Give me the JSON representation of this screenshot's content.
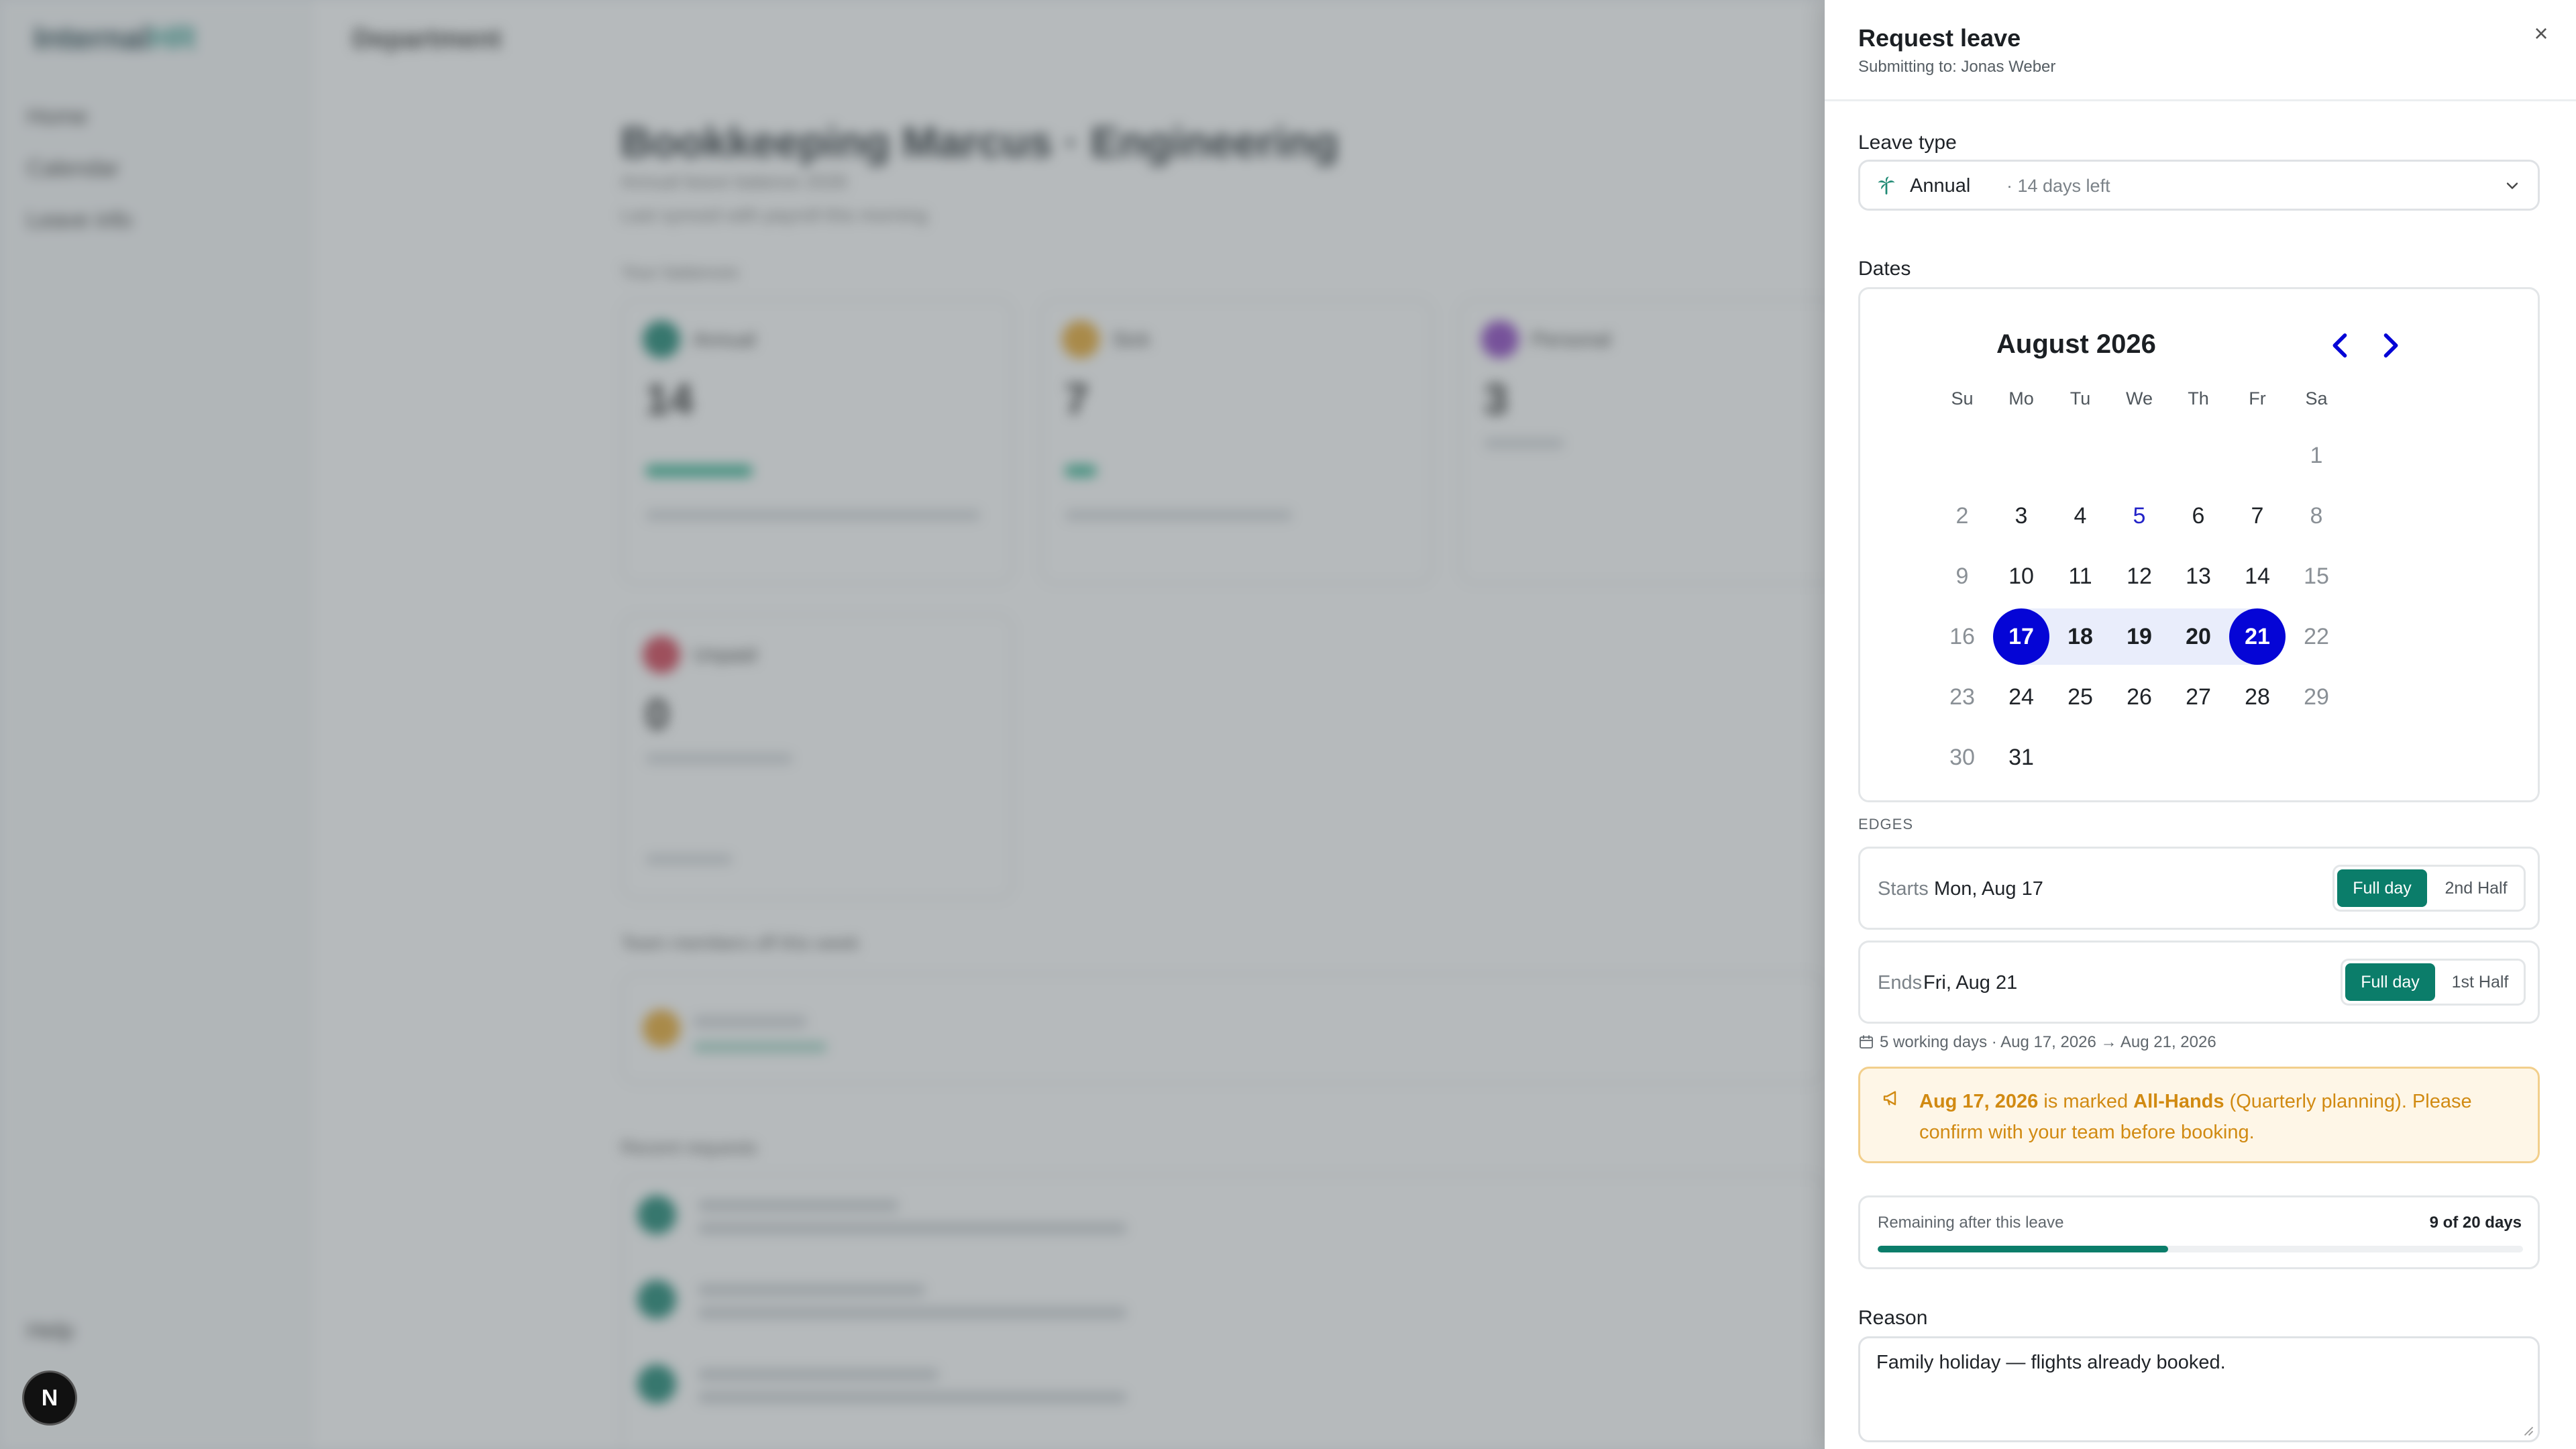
{
  "background": {
    "logo": {
      "part1": "Internal",
      "part2": "HR"
    },
    "topbar_title": "Department",
    "nav": [
      "Home",
      "Calendar",
      "Leave info"
    ],
    "bottom_nav": [
      "Help"
    ],
    "heading": "Bookkeeping Marcus · Engineering",
    "sub1": "Annual leave balance 2026",
    "sub2": "Last synced with payroll this morning",
    "section_balances": "Your balances",
    "cards": [
      {
        "label": "Annual",
        "value": "14",
        "color": "#15836f"
      },
      {
        "label": "Sick",
        "value": "7",
        "color": "#e8a72c"
      },
      {
        "label": "Personal",
        "value": "3",
        "color": "#8a3fc1"
      },
      {
        "label": "Unpaid",
        "value": "0",
        "color": "#d23b4f"
      }
    ],
    "section_team": "Team members off this week",
    "section_recent": "Recent requests",
    "badge_letter": "N"
  },
  "drawer": {
    "title": "Request leave",
    "subtitle": "Submitting to: Jonas Weber",
    "close_glyph": "×",
    "leave_type_label": "Leave type",
    "leave_type": {
      "selected": "Annual",
      "days_left": "· 14 days left",
      "icon": "palm-tree-icon"
    },
    "dates_label": "Dates",
    "calendar": {
      "month": "August 2026",
      "weekdays": [
        "Su",
        "Mo",
        "Tu",
        "We",
        "Th",
        "Fr",
        "Sa"
      ],
      "first_weekday_index": 6,
      "days_in_month": 31,
      "today": 5,
      "range_start": 17,
      "range_end": 21
    },
    "edges_label": "EDGES",
    "starts": {
      "lead": "Starts",
      "date": "Mon, Aug 17",
      "options": [
        "Full day",
        "2nd Half"
      ],
      "active": 0
    },
    "ends": {
      "lead": "Ends",
      "date": "Fri, Aug 21",
      "options": [
        "Full day",
        "1st Half"
      ],
      "active": 0
    },
    "summary": "5 working days · Aug 17, 2026 → Aug 21, 2026",
    "alert": {
      "date": "Aug 17, 2026",
      "middle": " is marked ",
      "event": "All-Hands",
      "rest": " (Quarterly planning). Please confirm with your team before booking."
    },
    "remaining": {
      "label": "Remaining after this leave",
      "value_text": "9 of 20 days",
      "remaining": 9,
      "total": 20
    },
    "reason_label": "Reason",
    "reason_text": "Family holiday — flights already booked."
  },
  "colors": {
    "accent_green": "#0b7d6a",
    "calendar_blue": "#0505d6",
    "range_tint": "#e9edfb",
    "alert_text": "#d18a12",
    "alert_bg": "#fef6e7"
  }
}
